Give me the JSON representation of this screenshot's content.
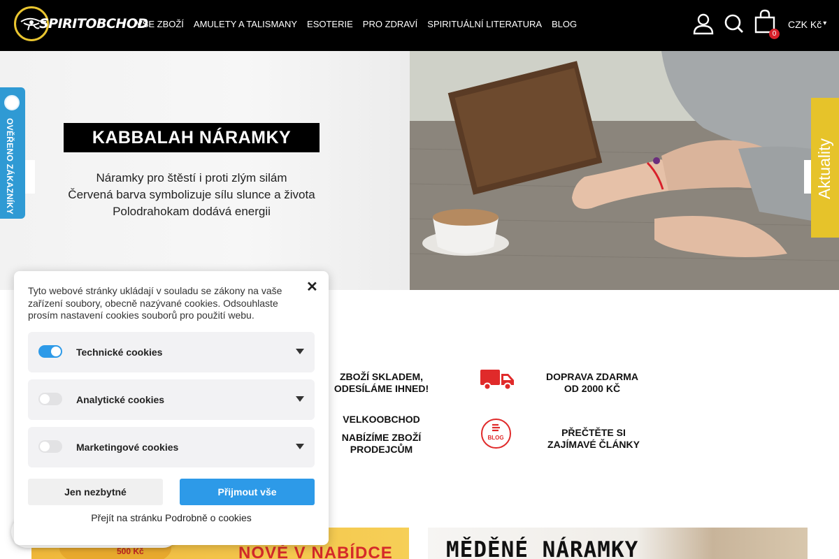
{
  "header": {
    "logo_text": "SPIRITOBCHOD",
    "nav": [
      "Vše zboží",
      "Amulety a talismany",
      "Esoterie",
      "Pro zdraví",
      "Spirituální literatura",
      "Blog"
    ],
    "cart_count": "0",
    "currency": "CZK Kč",
    "icons": [
      "user-icon",
      "search-icon",
      "cart-icon"
    ]
  },
  "hero": {
    "title": "KABBALAH NÁRAMKY",
    "lines": [
      "Náramky pro štěstí i proti zlým silám",
      "Červená barva symbolizuje sílu slunce a života",
      "Polodrahokam dodává energii"
    ]
  },
  "verified_badge": "OVĚŘENO ZÁKAZNÍKY",
  "news_tab": "Aktuality",
  "features": [
    {
      "text": "ZBOŽÍ SKLADEM,\nODESÍLÁME IHNED!"
    },
    {
      "text": "DOPRAVA ZDARMA\nOD 2000 KČ",
      "icon": "truck-icon"
    },
    {
      "text": "VELKOOBCHOD"
    },
    {
      "text": "NABÍZÍME ZBOŽÍ\nPRODEJCŮM"
    },
    {
      "text": "PŘEČTĚTE SI\nZAJÍMAVÉ ČLÁNKY",
      "icon": "blog-icon"
    }
  ],
  "blog_icon_label": "BLOG",
  "cookie": {
    "intro": "Tyto webové stránky ukládají v souladu se zákony na vaše zařízení soubory, obecně nazývané cookies. Odsouhlaste prosím nastavení cookies souborů pro použití webu.",
    "categories": [
      {
        "label": "Technické cookies",
        "enabled": true
      },
      {
        "label": "Analytické cookies",
        "enabled": false
      },
      {
        "label": "Marketingové cookies",
        "enabled": false
      }
    ],
    "btn_necessary": "Jen nezbytné",
    "btn_accept": "Přijmout vše",
    "links": "Přejít na stránku Podrobně o cookies",
    "accent": "#2d9ae8"
  },
  "banners": {
    "left_text": "NOVĚ V NABÍDCE",
    "left_price": "500 Kč",
    "right_text": "MĚDĚNÉ NÁRAMKY"
  }
}
